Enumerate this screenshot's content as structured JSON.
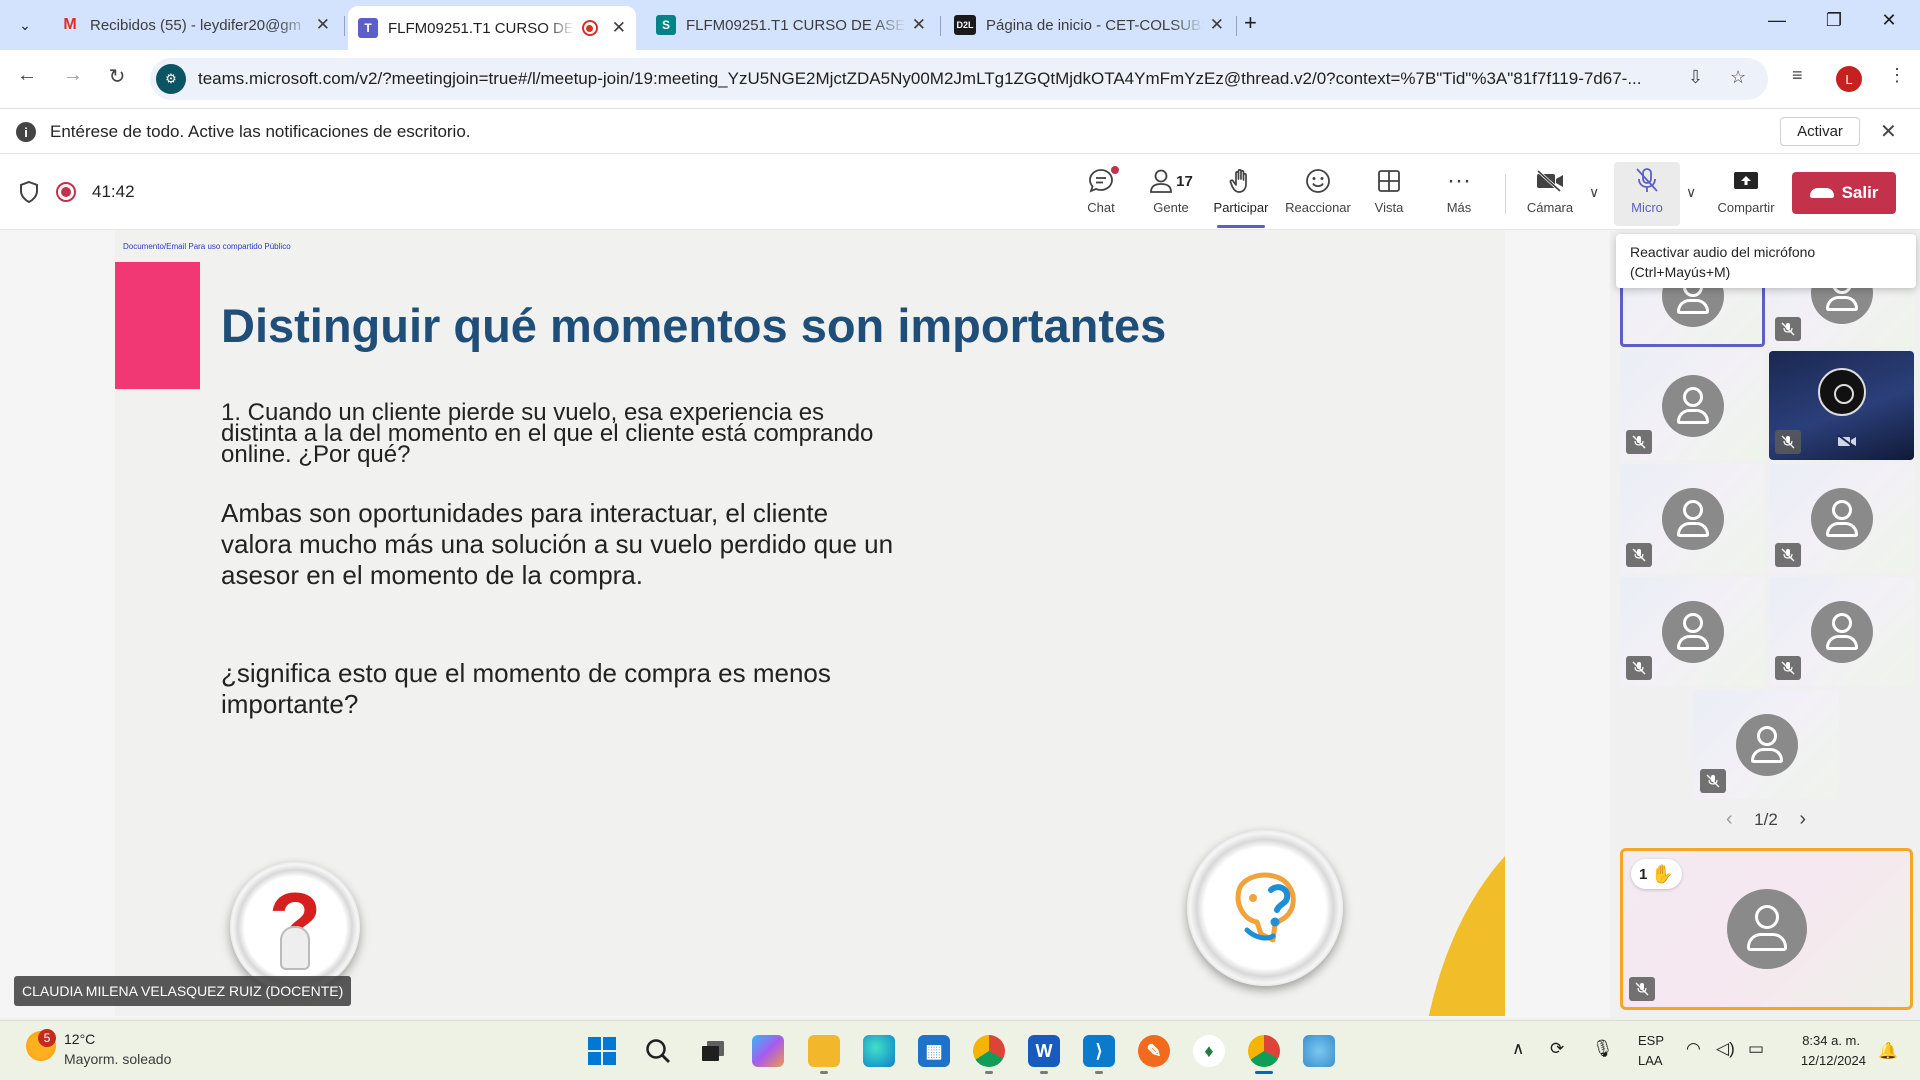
{
  "browser": {
    "tabs": [
      {
        "title": "Recibidos (55) - leydifer20@gm",
        "favicon": "gmail-icon"
      },
      {
        "title": "FLFM09251.T1 CURSO DE A",
        "favicon": "teams-icon",
        "recording": true
      },
      {
        "title": "FLFM09251.T1 CURSO DE ASES",
        "favicon": "sharepoint-icon"
      },
      {
        "title": "Página de inicio - CET-COLSUBS",
        "favicon": "d2l-icon",
        "favicon_text": "D2L"
      }
    ],
    "url": "teams.microsoft.com/v2/?meetingjoin=true#/l/meetup-join/19:meeting_YzU5NGE2MjctZDA5Ny00M2JmLTg1ZGQtMjdkOTA4YmFmYzEz@thread.v2/0?context=%7B\"Tid\"%3A\"81f7f119-7d67-...",
    "profile_initial": "L"
  },
  "notification": {
    "text": "Entérese de todo. Active las notificaciones de escritorio.",
    "button": "Activar"
  },
  "meeting": {
    "timer": "41:42",
    "toolbar": {
      "chat": "Chat",
      "people": "Gente",
      "people_count": "17",
      "raise": "Participar",
      "react": "Reaccionar",
      "view": "Vista",
      "more": "Más",
      "camera": "Cámara",
      "mic": "Micro",
      "share": "Compartir",
      "leave": "Salir"
    },
    "tooltip": "Reactivar audio del micrófono (Ctrl+Mayús+M)",
    "pager": "1/2",
    "self_hand_count": "1",
    "presenter_name": "CLAUDIA MILENA VELASQUEZ RUIZ (DOCENTE)"
  },
  "slide": {
    "classification": "Documento/Email Para uso compartido Público",
    "title": "Distinguir qué momentos son importantes",
    "question1": "1. Cuando un cliente pierde su vuelo, esa experiencia es distinta a la del momento en el que el cliente está comprando online. ¿Por qué?",
    "answer": "Ambas son oportunidades para interactuar, el cliente valora mucho más una solución a su vuelo perdido que un asesor en el momento de la compra.",
    "question2": "¿significa esto que el momento de compra es menos importante?"
  },
  "taskbar": {
    "weather_badge": "5",
    "temp": "12°C",
    "weather_desc": "Mayorm. soleado",
    "lang1": "ESP",
    "lang2": "LAA",
    "time": "8:34 a. m.",
    "date": "12/12/2024"
  },
  "colors": {
    "teams_purple": "#5b5fc7",
    "leave_red": "#c4314b",
    "slide_title": "#1f4e79",
    "slide_pink": "#f13875",
    "slide_yellow": "#f1be2a"
  }
}
